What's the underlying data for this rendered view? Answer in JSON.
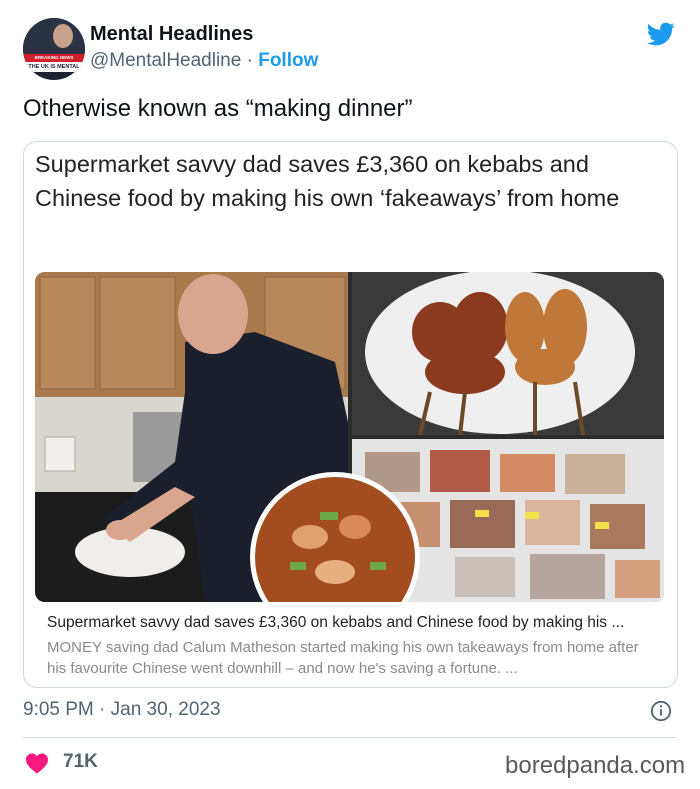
{
  "author": {
    "name": "Mental Headlines",
    "handle": "@MentalHeadline",
    "separator": " · ",
    "follow_label": "Follow",
    "avatar_banner_top": "BREAKING NEWS",
    "avatar_banner_bottom": "THE UK IS MENTAL"
  },
  "tweet": {
    "text": "Otherwise known as “making dinner”",
    "timestamp": "9:05 PM · Jan 30, 2023",
    "likes": "71K"
  },
  "card": {
    "headline": "Supermarket savvy dad saves £3,360 on kebabs and Chinese food by making his own ‘fakeaways’ from home",
    "link_title": "Supermarket savvy dad saves £3,360 on kebabs and Chinese food by making his ...",
    "link_description": "MONEY saving dad Calum Matheson started making his own takeaways from home after his favourite Chinese went downhill – and now he's saving a fortune. ..."
  },
  "watermark": "boredpanda.com",
  "colors": {
    "accent": "#1d9bf0",
    "heart": "#f91880",
    "secondary_text": "#536471"
  }
}
